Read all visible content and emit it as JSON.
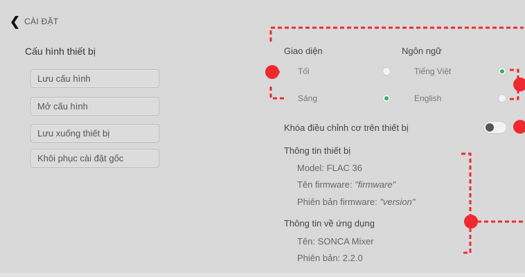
{
  "header": {
    "back_label": "CÀI ĐẶT"
  },
  "device_config": {
    "title": "Cấu hình thiết bị",
    "buttons": [
      "Lưu cấu hình",
      "Mở cấu hình",
      "Lưu xuống thiết bị",
      "Khôi phục cài đặt gốc"
    ]
  },
  "appearance": {
    "title": "Giao diện",
    "options": [
      {
        "label": "Tối",
        "selected": false
      },
      {
        "label": "Sáng",
        "selected": true
      }
    ]
  },
  "language": {
    "title": "Ngôn ngữ",
    "options": [
      {
        "label": "Tiếng Việt",
        "selected": true
      },
      {
        "label": "English",
        "selected": false
      }
    ]
  },
  "lock": {
    "label": "Khóa điều chỉnh cơ trên thiết bị",
    "enabled": false
  },
  "device_info": {
    "title": "Thông tin thiết bị",
    "model_label": "Model:",
    "model_value": "FLAC 36",
    "firmware_name_label": "Tên firmware:",
    "firmware_name_value": "\"firmware\"",
    "firmware_version_label": "Phiên bản firmware:",
    "firmware_version_value": "\"version\""
  },
  "app_info": {
    "title": "Thông tin về ứng dụng",
    "name_label": "Tên:",
    "name_value": "SONCA Mixer",
    "version_label": "Phiên bản:",
    "version_value": "2.2.0"
  },
  "colors": {
    "accent_green": "#2fae6a",
    "annotation_red": "#ee2a30",
    "background": "#d9d9d9"
  }
}
